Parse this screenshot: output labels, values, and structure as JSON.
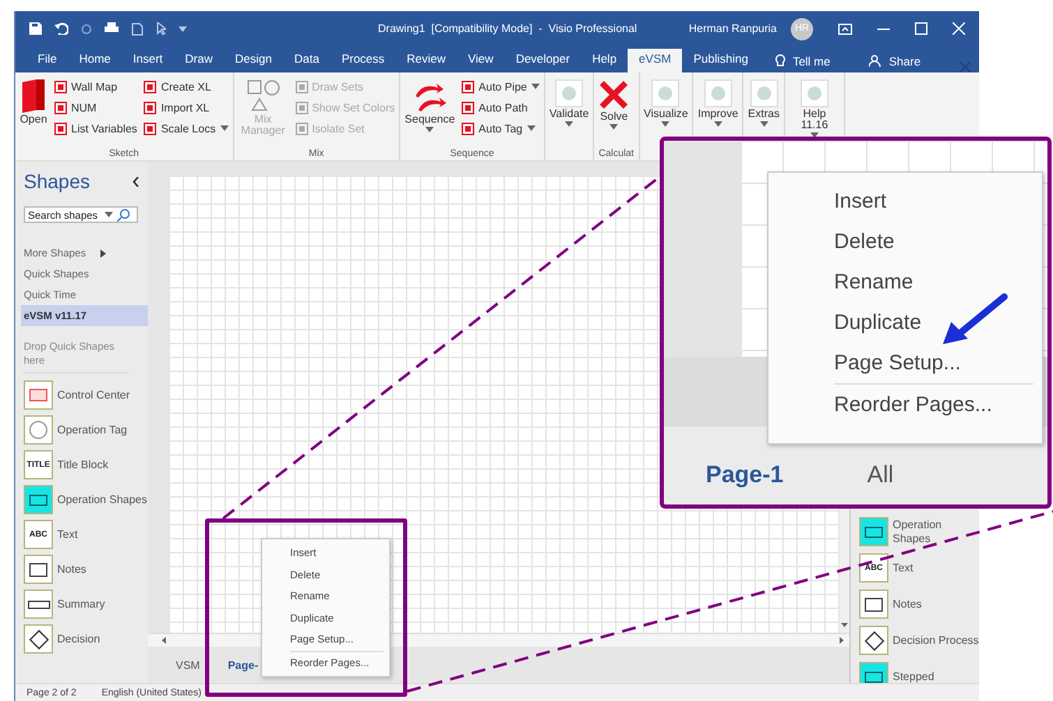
{
  "window": {
    "title": "Drawing1  [Compatibility Mode]  -  Visio Professional",
    "user_name": "Herman Ranpuria",
    "avatar_initials": "HR"
  },
  "ribbon_tabs": [
    {
      "label": "File",
      "selected": false
    },
    {
      "label": "Home",
      "selected": false
    },
    {
      "label": "Insert",
      "selected": false
    },
    {
      "label": "Draw",
      "selected": false
    },
    {
      "label": "Design",
      "selected": false
    },
    {
      "label": "Data",
      "selected": false
    },
    {
      "label": "Process",
      "selected": false
    },
    {
      "label": "Review",
      "selected": false
    },
    {
      "label": "View",
      "selected": false
    },
    {
      "label": "Developer",
      "selected": false
    },
    {
      "label": "Help",
      "selected": false
    },
    {
      "label": "eVSM",
      "selected": true
    },
    {
      "label": "Publishing",
      "selected": false
    }
  ],
  "tell_me": "Tell me",
  "share": "Share",
  "ribbon_groups": [
    {
      "label": "Sketch",
      "large": [
        {
          "label": "Open",
          "kind": "book"
        }
      ],
      "columns": [
        [
          {
            "label": "Wall Map"
          },
          {
            "label": "NUM"
          },
          {
            "label": "List Variables"
          }
        ],
        [
          {
            "label": "Create XL"
          },
          {
            "label": "Import XL"
          },
          {
            "label": "Scale Locs",
            "dropdown": true
          }
        ]
      ]
    },
    {
      "label": "Mix",
      "disabled": true,
      "large": [
        {
          "label": "Mix Manager",
          "kind": "shapes"
        }
      ],
      "columns": [
        [
          {
            "label": "Draw Sets"
          },
          {
            "label": "Show Set Colors"
          },
          {
            "label": "Isolate Set"
          }
        ]
      ]
    },
    {
      "label": "Sequence",
      "large": [
        {
          "label": "Sequence",
          "kind": "arrows",
          "dropdown": true
        }
      ],
      "columns": [
        [
          {
            "label": "Auto Pipe",
            "dropdown": true
          },
          {
            "label": "Auto Path"
          },
          {
            "label": "Auto Tag",
            "dropdown": true
          }
        ]
      ]
    },
    {
      "large": [
        {
          "label": "Validate",
          "kind": "dot",
          "dropdown": true
        }
      ]
    },
    {
      "label": "Calculat",
      "large": [
        {
          "label": "Solve",
          "kind": "cross",
          "dropdown": true
        }
      ]
    },
    {
      "large": [
        {
          "label": "Visualize",
          "kind": "dot",
          "dropdown": true
        }
      ]
    },
    {
      "large": [
        {
          "label": "Improve",
          "kind": "dot",
          "dropdown": true
        }
      ]
    },
    {
      "large": [
        {
          "label": "Extras",
          "kind": "dot",
          "dropdown": true
        }
      ]
    },
    {
      "large": [
        {
          "label": "Help 11.16",
          "kind": "dot",
          "dropdown": true
        }
      ]
    }
  ],
  "shapes_panel": {
    "title": "Shapes",
    "search": {
      "placeholder": "Search shapes"
    },
    "nav": [
      {
        "label": "More Shapes",
        "submenu": true,
        "selected": false
      },
      {
        "label": "Quick Shapes",
        "selected": false
      },
      {
        "label": "Quick Time",
        "selected": false
      },
      {
        "label": "eVSM v11.17",
        "selected": true
      }
    ],
    "drop_hint": "Drop Quick Shapes here",
    "stencil": [
      {
        "label": "Control Center",
        "kind": "control"
      },
      {
        "label": "Operation Tag",
        "kind": "tag"
      },
      {
        "label": "Title Block",
        "kind": "text",
        "icon_text": "TITLE"
      },
      {
        "label": "Operation Shapes",
        "kind": "cyan"
      },
      {
        "label": "Text",
        "kind": "text",
        "icon_text": "ABC"
      },
      {
        "label": "Notes",
        "kind": "lines"
      },
      {
        "label": "Summary",
        "kind": "bar"
      },
      {
        "label": "Decision",
        "kind": "diamond"
      }
    ]
  },
  "page_tabs": [
    {
      "label": "VSM",
      "selected": false
    },
    {
      "label": "Page-",
      "selected": true
    }
  ],
  "right_stencil": [
    {
      "label": "Operation Shapes",
      "kind": "cyan"
    },
    {
      "label": "Text",
      "kind": "text",
      "icon_text": "ABC"
    },
    {
      "label": "Notes",
      "kind": "lines"
    },
    {
      "label": "Decision Process",
      "kind": "diamond"
    },
    {
      "label": "Stepped",
      "kind": "cyan"
    }
  ],
  "status_bar": [
    "Page 2 of 2",
    "English (United States)"
  ],
  "context_menu": [
    {
      "label": "Insert"
    },
    {
      "label": "Delete"
    },
    {
      "label": "Rename"
    },
    {
      "label": "Duplicate"
    },
    {
      "label": "Page Setup..."
    },
    {
      "label": "Reorder Pages...",
      "separator_before": true
    }
  ],
  "inset": {
    "context_menu": [
      {
        "label": "Insert"
      },
      {
        "label": "Delete"
      },
      {
        "label": "Rename"
      },
      {
        "label": "Duplicate"
      },
      {
        "label": "Page Setup..."
      },
      {
        "label": "Reorder Pages...",
        "separator_before": true
      }
    ],
    "page_tabs": [
      {
        "label": "Page-1",
        "selected": true
      },
      {
        "label": "All",
        "selected": false
      }
    ]
  }
}
